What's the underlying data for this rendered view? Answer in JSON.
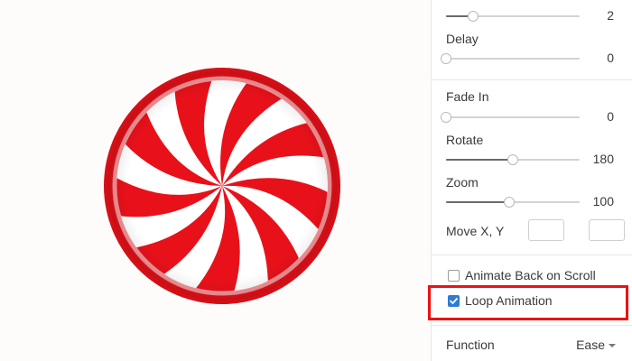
{
  "canvas": {
    "candy": {
      "icon": "peppermint-candy-icon",
      "primary_color": "#e8111a",
      "secondary_color": "#ffffff"
    }
  },
  "panel": {
    "top_slider": {
      "value": "2",
      "level": 0.2
    },
    "delay": {
      "label": "Delay",
      "value": "0",
      "level": 0.0
    },
    "fade_in": {
      "label": "Fade In",
      "value": "0",
      "level": 0.0
    },
    "rotate": {
      "label": "Rotate",
      "value": "180",
      "level": 0.5
    },
    "zoom": {
      "label": "Zoom",
      "value": "100",
      "level": 0.47
    },
    "move": {
      "label": "Move X, Y",
      "x_value": "",
      "y_value": ""
    },
    "animate_back": {
      "label": "Animate Back on Scroll",
      "checked": false
    },
    "loop_animation": {
      "label": "Loop Animation",
      "checked": true
    },
    "function": {
      "label": "Function",
      "value": "Ease",
      "icon": "caret-down-icon"
    }
  },
  "colors": {
    "accent": "#2f7bd8",
    "highlight": "#ee1111"
  }
}
